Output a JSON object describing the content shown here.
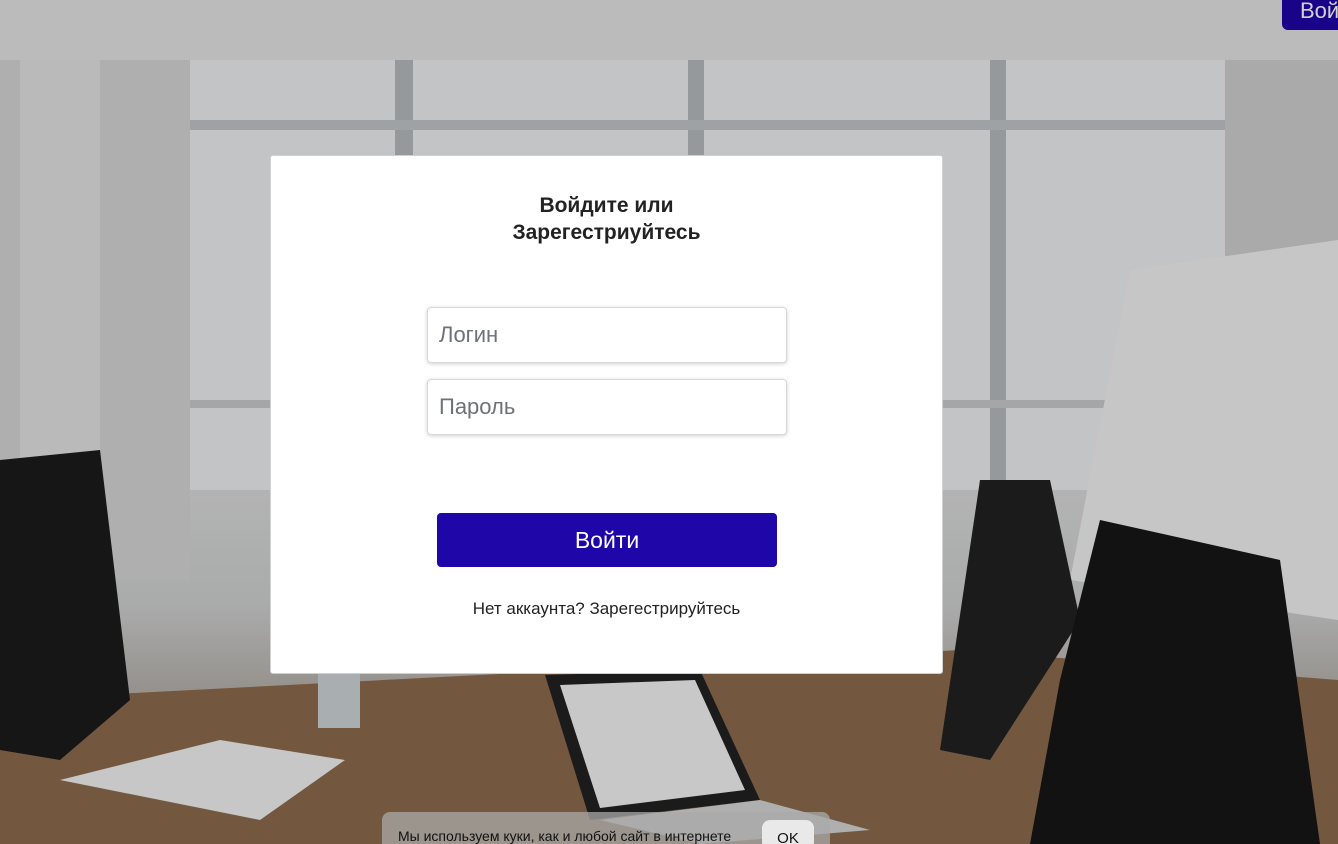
{
  "header": {
    "top_button_label": "Вой"
  },
  "modal": {
    "title_line1": "Войдите или",
    "title_line2": "Зарегестриуйтесь",
    "login_placeholder": "Логин",
    "password_placeholder": "Пароль",
    "submit_label": "Войти",
    "register_prompt": "Нет аккаунта? Зарегестрируйтесь"
  },
  "cookie_banner": {
    "text": "Мы используем куки, как и любой сайт в интернете",
    "ok_label": "OK"
  },
  "colors": {
    "accent": "#1f06a8",
    "modal_background": "#ffffff"
  }
}
